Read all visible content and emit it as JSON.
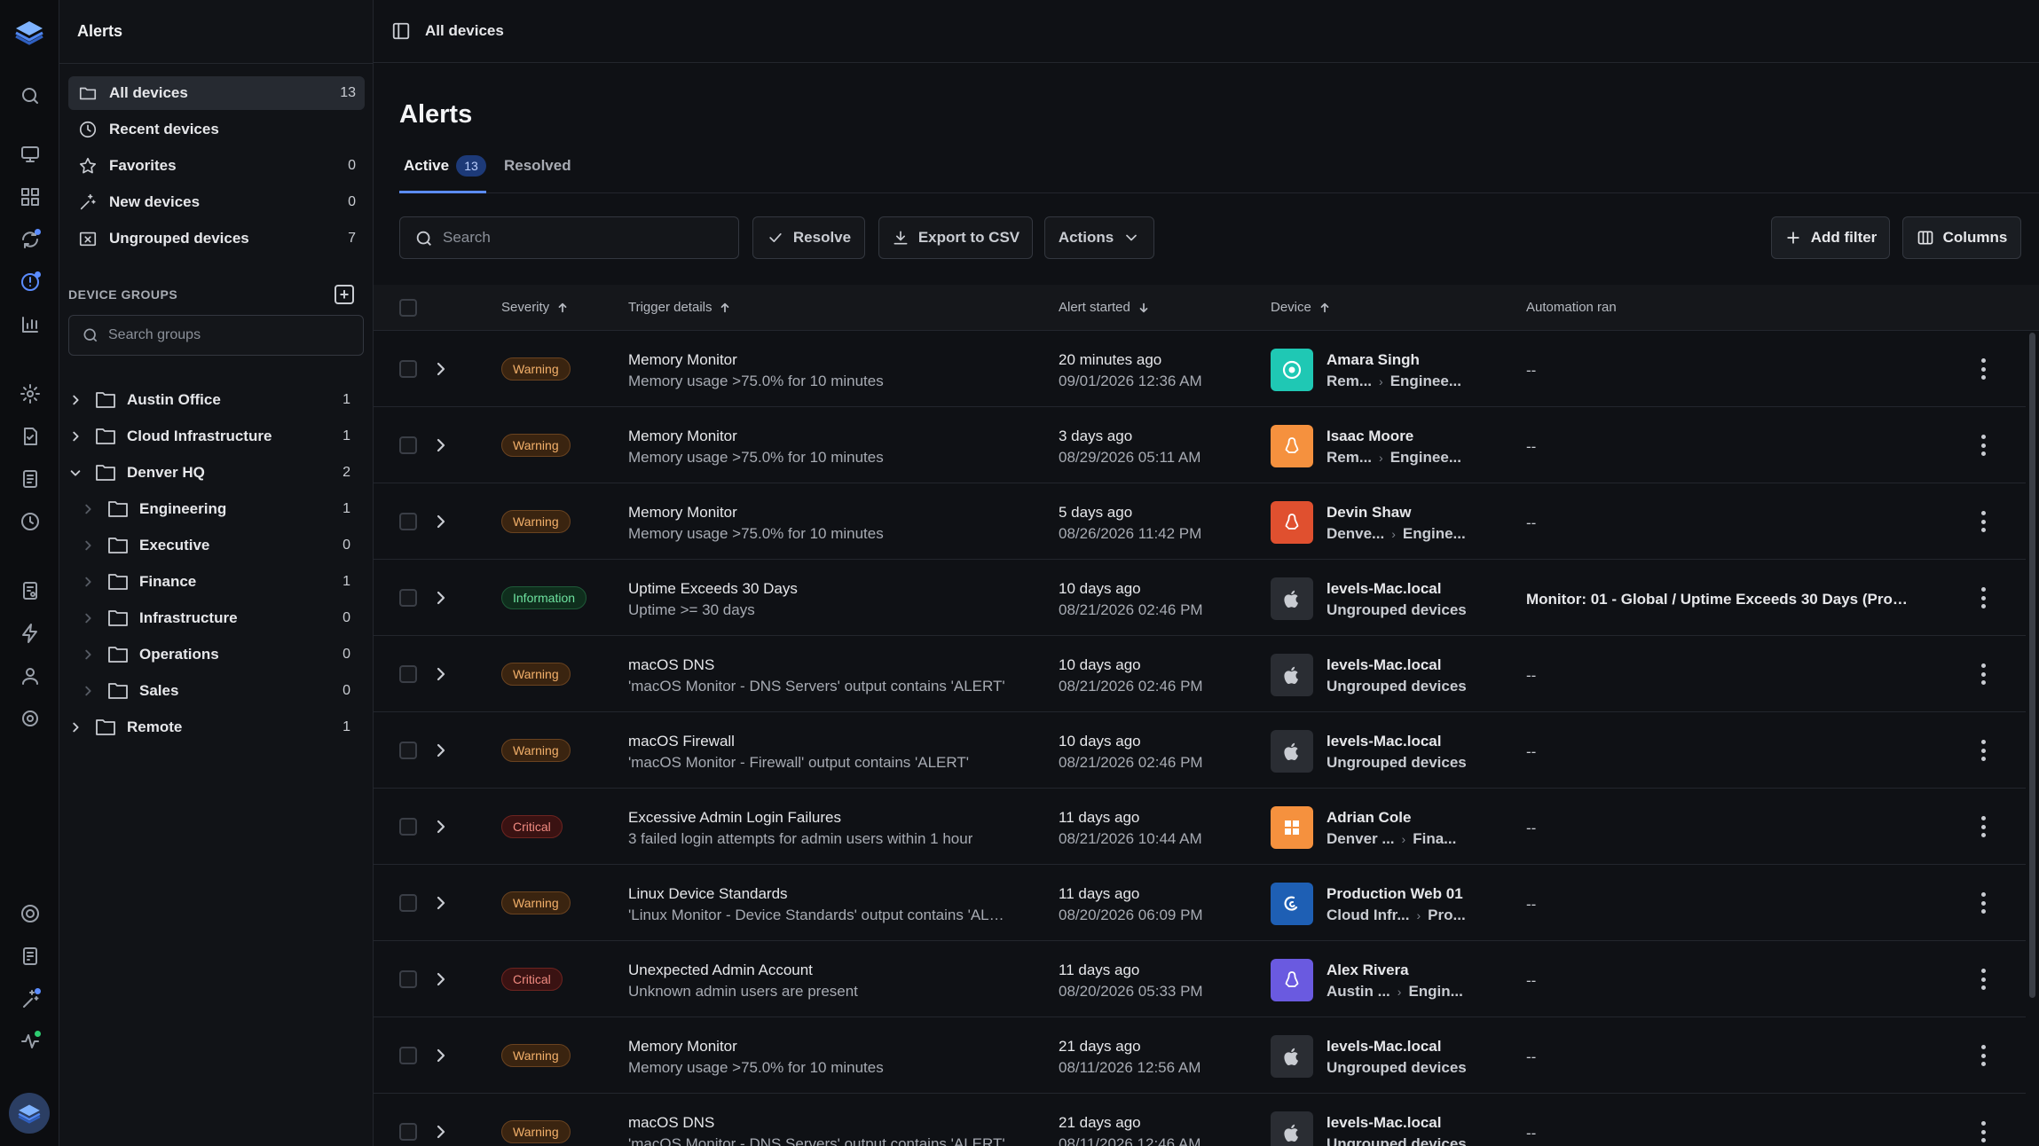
{
  "sidebar": {
    "title": "Alerts",
    "nav": [
      {
        "label": "All devices",
        "count": "13",
        "icon": "folder-icon"
      },
      {
        "label": "Recent devices",
        "count": "",
        "icon": "clock-icon"
      },
      {
        "label": "Favorites",
        "count": "0",
        "icon": "star-icon"
      },
      {
        "label": "New devices",
        "count": "0",
        "icon": "sparkle-icon"
      },
      {
        "label": "Ungrouped devices",
        "count": "7",
        "icon": "folder-x-icon"
      }
    ],
    "groups_label": "DEVICE GROUPS",
    "groups_search_placeholder": "Search groups",
    "groups": [
      {
        "label": "Austin Office",
        "count": "1"
      },
      {
        "label": "Cloud Infrastructure",
        "count": "1"
      },
      {
        "label": "Denver HQ",
        "count": "2"
      },
      {
        "label": "Engineering",
        "count": "1"
      },
      {
        "label": "Executive",
        "count": "0"
      },
      {
        "label": "Finance",
        "count": "1"
      },
      {
        "label": "Infrastructure",
        "count": "0"
      },
      {
        "label": "Operations",
        "count": "0"
      },
      {
        "label": "Sales",
        "count": "0"
      },
      {
        "label": "Remote",
        "count": "1"
      }
    ]
  },
  "topbar": {
    "breadcrumb": "All devices"
  },
  "page": {
    "title": "Alerts",
    "tabs": [
      {
        "label": "Active",
        "badge": "13"
      },
      {
        "label": "Resolved"
      }
    ]
  },
  "toolbar": {
    "search_placeholder": "Search",
    "resolve": "Resolve",
    "export": "Export to CSV",
    "actions": "Actions",
    "add_filter": "Add filter",
    "columns": "Columns"
  },
  "table": {
    "headers": {
      "severity": "Severity",
      "trigger": "Trigger details",
      "started": "Alert started",
      "device": "Device",
      "automation": "Automation ran"
    },
    "rows": [
      {
        "severity": "Warning",
        "sev_class": "warning",
        "trigger": "Memory Monitor",
        "trigger_detail": "Memory usage >75.0% for 10 minutes",
        "ago": "20 minutes ago",
        "date": "09/01/2026 12:36 AM",
        "device": "Amara Singh",
        "path1": "Rem...",
        "path2": "Enginee...",
        "os": "chrome",
        "icon_color": "#1fc8b4",
        "automation": "--"
      },
      {
        "severity": "Warning",
        "sev_class": "warning",
        "trigger": "Memory Monitor",
        "trigger_detail": "Memory usage >75.0% for 10 minutes",
        "ago": "3 days ago",
        "date": "08/29/2026 05:11 AM",
        "device": "Isaac Moore",
        "path1": "Rem...",
        "path2": "Enginee...",
        "os": "linux",
        "icon_color": "#f5913e",
        "automation": "--"
      },
      {
        "severity": "Warning",
        "sev_class": "warning",
        "trigger": "Memory Monitor",
        "trigger_detail": "Memory usage >75.0% for 10 minutes",
        "ago": "5 days ago",
        "date": "08/26/2026 11:42 PM",
        "device": "Devin Shaw",
        "path1": "Denve...",
        "path2": "Engine...",
        "os": "linux",
        "icon_color": "#e0502f",
        "automation": "--"
      },
      {
        "severity": "Information",
        "sev_class": "information",
        "trigger": "Uptime Exceeds 30 Days",
        "trigger_detail": "Uptime >= 30 days",
        "ago": "10 days ago",
        "date": "08/21/2026 02:46 PM",
        "device": "levels-Mac.local",
        "path1": "Ungrouped devices",
        "path2": "",
        "os": "apple",
        "icon_color": "#2a2d33",
        "automation": "Monitor: 01 - Global / Uptime Exceeds 30 Days (Prom..."
      },
      {
        "severity": "Warning",
        "sev_class": "warning",
        "trigger": "macOS DNS",
        "trigger_detail": "'macOS Monitor - DNS Servers' output contains 'ALERT'",
        "ago": "10 days ago",
        "date": "08/21/2026 02:46 PM",
        "device": "levels-Mac.local",
        "path1": "Ungrouped devices",
        "path2": "",
        "os": "apple",
        "icon_color": "#2a2d33",
        "automation": "--"
      },
      {
        "severity": "Warning",
        "sev_class": "warning",
        "trigger": "macOS Firewall",
        "trigger_detail": "'macOS Monitor - Firewall' output contains 'ALERT'",
        "ago": "10 days ago",
        "date": "08/21/2026 02:46 PM",
        "device": "levels-Mac.local",
        "path1": "Ungrouped devices",
        "path2": "",
        "os": "apple",
        "icon_color": "#2a2d33",
        "automation": "--"
      },
      {
        "severity": "Critical",
        "sev_class": "critical",
        "trigger": "Excessive Admin Login Failures",
        "trigger_detail": "3 failed login attempts for admin users within 1 hour",
        "ago": "11 days ago",
        "date": "08/21/2026 10:44 AM",
        "device": "Adrian Cole",
        "path1": "Denver ...",
        "path2": "Fina...",
        "os": "windows",
        "icon_color": "#f5913e",
        "automation": "--"
      },
      {
        "severity": "Warning",
        "sev_class": "warning",
        "trigger": "Linux Device Standards",
        "trigger_detail": "'Linux Monitor - Device Standards' output contains 'ALE...",
        "ago": "11 days ago",
        "date": "08/20/2026 06:09 PM",
        "device": "Production Web 01",
        "path1": "Cloud Infr...",
        "path2": "Pro...",
        "os": "debian",
        "icon_color": "#1e5fb4",
        "automation": "--"
      },
      {
        "severity": "Critical",
        "sev_class": "critical",
        "trigger": "Unexpected Admin Account",
        "trigger_detail": "Unknown admin users are present",
        "ago": "11 days ago",
        "date": "08/20/2026 05:33 PM",
        "device": "Alex Rivera",
        "path1": "Austin ...",
        "path2": "Engin...",
        "os": "linux",
        "icon_color": "#6a5ae0",
        "automation": "--"
      },
      {
        "severity": "Warning",
        "sev_class": "warning",
        "trigger": "Memory Monitor",
        "trigger_detail": "Memory usage >75.0% for 10 minutes",
        "ago": "21 days ago",
        "date": "08/11/2026 12:56 AM",
        "device": "levels-Mac.local",
        "path1": "Ungrouped devices",
        "path2": "",
        "os": "apple",
        "icon_color": "#2a2d33",
        "automation": "--"
      },
      {
        "severity": "Warning",
        "sev_class": "warning",
        "trigger": "macOS DNS",
        "trigger_detail": "'macOS Monitor - DNS Servers' output contains 'ALERT'",
        "ago": "21 days ago",
        "date": "08/11/2026 12:46 AM",
        "device": "levels-Mac.local",
        "path1": "Ungrouped devices",
        "path2": "",
        "os": "apple",
        "icon_color": "#2a2d33",
        "automation": "--"
      }
    ]
  }
}
